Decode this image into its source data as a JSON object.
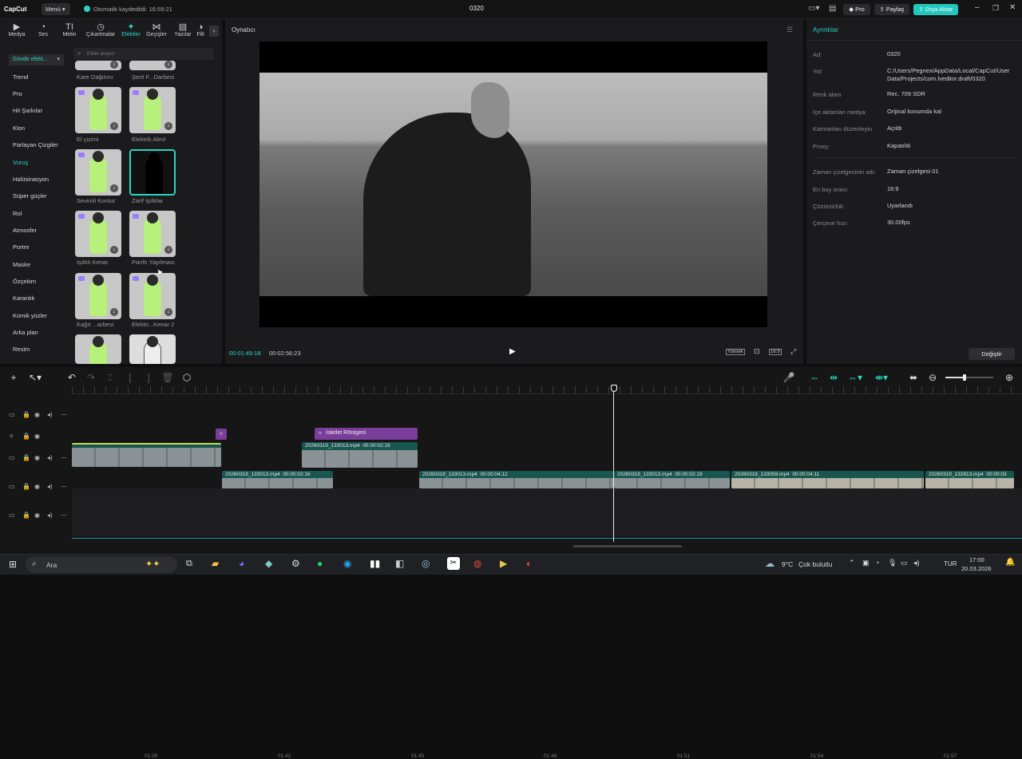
{
  "app": {
    "logo": "CapCut",
    "menu_label": "Menü",
    "autosave_text": "Otomatik kaydedildi: 16:59:21",
    "project_title": "0320",
    "pro_label": "Pro",
    "share_label": "Paylaş",
    "export_label": "Dışa Aktar"
  },
  "tabs": [
    {
      "label": "Medya",
      "icon": "media-icon"
    },
    {
      "label": "Ses",
      "icon": "audio-icon"
    },
    {
      "label": "Metin",
      "icon": "text-icon"
    },
    {
      "label": "Çıkartmalar",
      "icon": "sticker-icon"
    },
    {
      "label": "Efektler",
      "icon": "effects-icon"
    },
    {
      "label": "Geçişler",
      "icon": "transitions-icon"
    },
    {
      "label": "Yazılar",
      "icon": "captions-icon"
    },
    {
      "label": "Filt",
      "icon": "filters-icon"
    }
  ],
  "effects": {
    "category_dropdown": "Gövde efekt...",
    "search_placeholder": "Efekt arayın",
    "categories": [
      "Trend",
      "Pro",
      "Hit Şarkılar",
      "Klon",
      "Parlayan Çizgiler",
      "Vuruş",
      "Halüsinasyon",
      "Süper güçler",
      "Rol",
      "Atmosfer",
      "Portre",
      "Maske",
      "Özçekim",
      "Karanlık",
      "Komik yüzler",
      "Arka plan",
      "Resim"
    ],
    "active_category": "Vuruş",
    "items": [
      {
        "label": "Kare Dağılımı"
      },
      {
        "label": "Şerit F...Darbesi"
      },
      {
        "label": "El çizimi"
      },
      {
        "label": "Elektrik Alevi"
      },
      {
        "label": "Sevimli Kontur"
      },
      {
        "label": "Zarif Işıltılar"
      },
      {
        "label": "Işıltılı Kenar"
      },
      {
        "label": "Parıltı Yayılması"
      },
      {
        "label": "Kağıt ...arbesi"
      },
      {
        "label": "Elektri...Kenar 2"
      }
    ]
  },
  "player": {
    "title": "Oynatıcı",
    "current_time": "00:01:49:18",
    "total_time": "00:02:56:23",
    "quality_label": "Yüksek",
    "ratio_label": "16:9"
  },
  "details": {
    "title": "Ayrıntılar",
    "rows": [
      {
        "label": "Ad:",
        "value": "0320"
      },
      {
        "label": "Yol:",
        "value": "C:/Users/Pegnex/AppData/Local/CapCut/User Data/Projects/com.lveditor.draft/0320"
      },
      {
        "label": "Renk alanı",
        "value": "Rec. 709 SDR"
      },
      {
        "label": "İçe aktarılan medya:",
        "value": "Orijinal konumda kal"
      },
      {
        "label": "Katmanları düzenleyin",
        "value": "Açıldı"
      },
      {
        "label": "Proxy:",
        "value": "Kapatıldı"
      },
      {
        "label": "Zaman çizelgesinin adı:",
        "value": "Zaman çizelgesi 01"
      },
      {
        "label": "En boy oranı:",
        "value": "16:9"
      },
      {
        "label": "Çözünürlük:",
        "value": "Uyarlandı"
      },
      {
        "label": "Çerçeve hızı:",
        "value": "30.00fps"
      }
    ],
    "modify_label": "Değiştir"
  },
  "timeline": {
    "ticks": [
      "01:39",
      "01:42",
      "01:45",
      "01:48",
      "01:51",
      "01:54",
      "01:57"
    ],
    "effect_clip": "İskelet Röntgeni",
    "clips": [
      {
        "name": "20260319_133013.mp4",
        "duration": "00:00:02:19"
      },
      {
        "name": "20260319_133013.mp4",
        "duration": "00:00:02:16"
      },
      {
        "name": "20260319_133013.mp4",
        "duration": "00:00:04:12"
      },
      {
        "name": "20260319_133013.mp4",
        "duration": "00:00:02:19"
      },
      {
        "name": "20260319_133059.mp4",
        "duration": "00:00:04:11"
      },
      {
        "name": "20260319_132813.mp4",
        "duration": "00:00:03"
      }
    ]
  },
  "taskbar": {
    "search_placeholder": "Ara",
    "weather_temp": "9°C",
    "weather_text": "Çok bulutlu",
    "lang": "TUR",
    "time": "17:00",
    "date": "20.03.2026"
  },
  "colors": {
    "accent": "#2ad4c6",
    "clip": "#185650",
    "effect_clip": "#7b3d9a"
  }
}
